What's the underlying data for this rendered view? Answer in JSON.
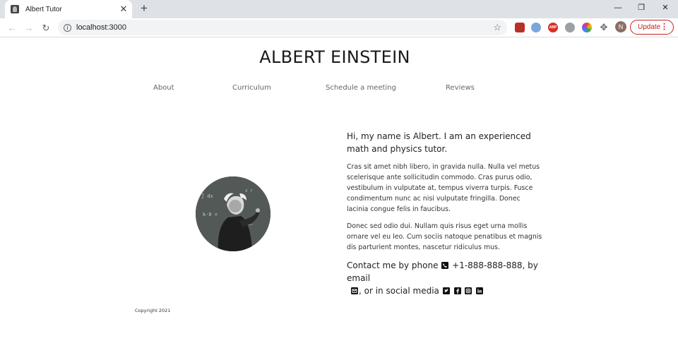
{
  "browser": {
    "tab_title": "Albert Tutor",
    "new_tab_glyph": "+",
    "url": "localhost:3000",
    "update_label": "Update",
    "profile_initial": "N",
    "extensions": [
      "photo-extension-icon",
      "compass-extension-icon",
      "adblock-extension-icon",
      "gear-extension-icon",
      "color-wheel-extension-icon",
      "puzzle-extensions-icon"
    ]
  },
  "site": {
    "title": "ALBERT EINSTEIN",
    "nav": [
      "About",
      "Curriculum",
      "Schedule a meeting",
      "Reviews"
    ]
  },
  "bio": {
    "lead": "Hi, my name is Albert. I am an experienced math and physics tutor.",
    "paragraph1": "Cras sit amet nibh libero, in gravida nulla. Nulla vel metus scelerisque ante sollicitudin commodo. Cras purus odio, vestibulum in vulputate at, tempus viverra turpis. Fusce condimentum nunc ac nisi vulputate fringilla. Donec lacinia congue felis in faucibus.",
    "paragraph2": "Donec sed odio dui. Nullam quis risus eget urna mollis ornare vel eu leo. Cum sociis natoque penatibus et magnis dis parturient montes, nascetur ridiculus mus.",
    "contact_prefix": "Contact me by phone",
    "phone": "+1-888-888-888",
    "contact_mid": ", by email",
    "contact_suffix": ", or in social media"
  },
  "footer": {
    "copyright": "Copyright 2021"
  },
  "colors": {
    "update_red": "#c5221f",
    "tabbar": "#dee1e6"
  }
}
